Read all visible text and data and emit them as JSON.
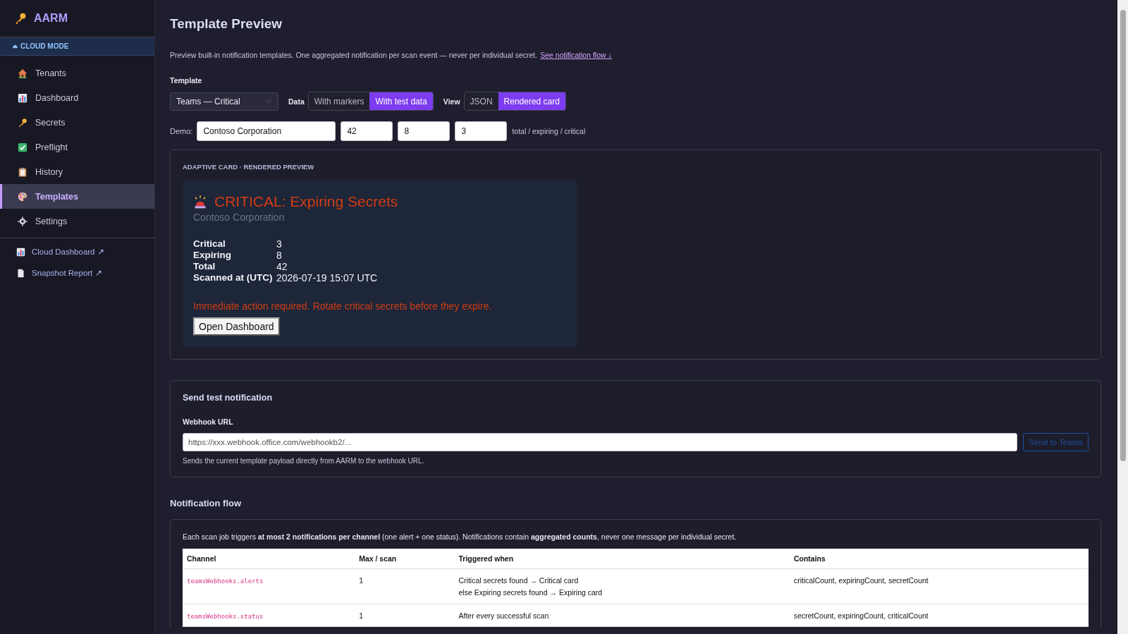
{
  "app": {
    "name": "AARM",
    "mode": "CLOUD MODE"
  },
  "sidebar": {
    "items": [
      {
        "label": "Tenants",
        "selected": false
      },
      {
        "label": "Dashboard",
        "selected": false
      },
      {
        "label": "Secrets",
        "selected": false
      },
      {
        "label": "Preflight",
        "selected": false
      },
      {
        "label": "History",
        "selected": false
      },
      {
        "label": "Templates",
        "selected": true
      },
      {
        "label": "Settings",
        "selected": false
      }
    ],
    "links": [
      {
        "label": "Cloud Dashboard ↗"
      },
      {
        "label": "Snapshot Report ↗"
      }
    ]
  },
  "page": {
    "title": "Template Preview",
    "description": "Preview built-in notification templates. One aggregated notification per scan event — never per individual secret.",
    "link": "See notification flow ↓"
  },
  "template": {
    "label": "Template",
    "value": "Teams — Critical"
  },
  "data_toggle": {
    "label": "Data",
    "options": [
      {
        "label": "With markers",
        "selected": false
      },
      {
        "label": "With test data",
        "selected": true
      }
    ]
  },
  "view_toggle": {
    "label": "View",
    "options": [
      {
        "label": "JSON",
        "selected": false
      },
      {
        "label": "Rendered card",
        "selected": true
      }
    ]
  },
  "demo": {
    "label": "Demo:",
    "fields": [
      "Contoso Corporation",
      "42",
      "8",
      "3"
    ],
    "hint": "total / expiring / critical"
  },
  "preview": {
    "heading": "ADAPTIVE CARD · RENDERED PREVIEW",
    "card": {
      "title": "CRITICAL: Expiring Secrets",
      "subtitle": "Contoso Corporation",
      "facts": [
        {
          "name": "Critical",
          "value": "3"
        },
        {
          "name": "Expiring",
          "value": "8"
        },
        {
          "name": "Total",
          "value": "42"
        },
        {
          "name": "Scanned at (UTC)",
          "value": "2026-07-19 15:07 UTC"
        }
      ],
      "alert": "Immediate action required. Rotate critical secrets before they expire.",
      "button": "Open Dashboard"
    }
  },
  "send": {
    "title": "Send test notification",
    "field_label": "Webhook URL",
    "placeholder": "https://xxx.webhook.office.com/webhookb2/...",
    "button": "Send to Teams",
    "button_disabled": true,
    "hint": "Sends the current template payload directly from AARM to the webhook URL."
  },
  "flow": {
    "title": "Notification flow",
    "intro": "Each scan job triggers **at most 2 notifications per channel** (one alert + one status). Notifications contain **aggregated counts**, never one message per individual secret.",
    "table": {
      "columns": [
        "Channel",
        "Max / scan",
        "Triggered when",
        "Contains"
      ],
      "rows": [
        {
          "channel": "teamsWebhooks.alerts",
          "max": "1",
          "triggered": [
            "Critical secrets found → Critical card",
            "else Expiring secrets found → Expiring card"
          ],
          "contains": "criticalCount, expiringCount, secretCount"
        },
        {
          "channel": "teamsWebhooks.status",
          "max": "1",
          "triggered": [
            "After every successful scan"
          ],
          "contains": "secretCount, expiringCount, criticalCount"
        }
      ]
    }
  }
}
